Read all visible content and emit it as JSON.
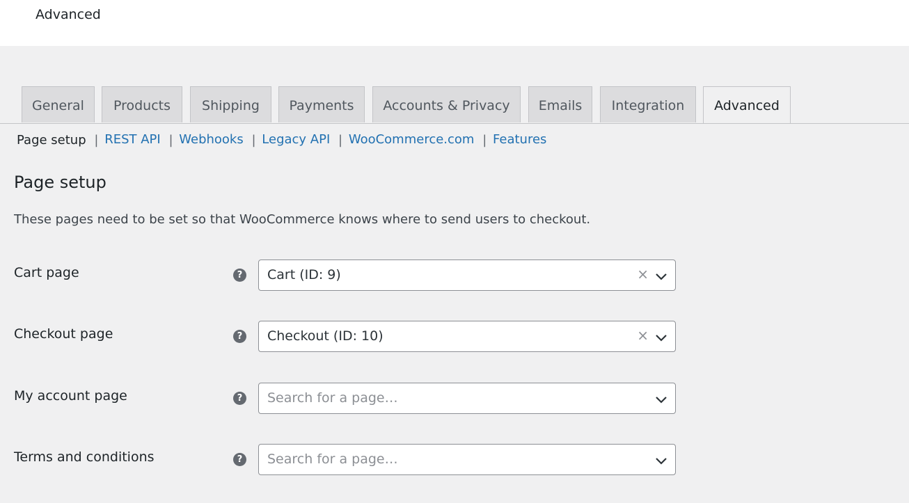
{
  "header": {
    "title": "Advanced"
  },
  "tabs": [
    {
      "label": "General"
    },
    {
      "label": "Products"
    },
    {
      "label": "Shipping"
    },
    {
      "label": "Payments"
    },
    {
      "label": "Accounts & Privacy"
    },
    {
      "label": "Emails"
    },
    {
      "label": "Integration"
    },
    {
      "label": "Advanced",
      "active": true
    }
  ],
  "subnav": {
    "current": "Page setup",
    "links": [
      "REST API",
      "Webhooks",
      "Legacy API",
      "WooCommerce.com",
      "Features"
    ],
    "separator": "|"
  },
  "section": {
    "title": "Page setup",
    "description": "These pages need to be set so that WooCommerce knows where to send users to checkout."
  },
  "fields": [
    {
      "label": "Cart page",
      "value": "Cart (ID: 9)",
      "placeholder": "",
      "clearable": true
    },
    {
      "label": "Checkout page",
      "value": "Checkout (ID: 10)",
      "placeholder": "",
      "clearable": true
    },
    {
      "label": "My account page",
      "value": "",
      "placeholder": "Search for a page…",
      "clearable": false
    },
    {
      "label": "Terms and conditions",
      "value": "",
      "placeholder": "Search for a page…",
      "clearable": false
    }
  ],
  "icons": {
    "help": "?",
    "clear": "×"
  },
  "colors": {
    "link": "#2271b1",
    "background": "#f0f0f1",
    "tab_inactive": "#dcdcde"
  }
}
